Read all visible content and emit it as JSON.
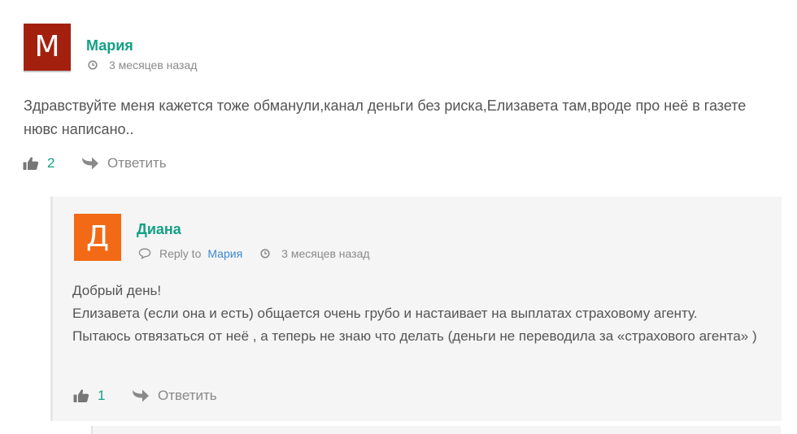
{
  "comment": {
    "avatar_letter": "M",
    "avatar_color": "#a3200f",
    "author": "Мария",
    "time": "3 месяцев назад",
    "text": "Здравствуйте меня кажется тоже обманули,канал деньги без риска,Елизавета там,вроде про неё в газете нювс написано..",
    "likes": "2",
    "reply_label": "Ответить"
  },
  "reply": {
    "avatar_letter": "Д",
    "avatar_color": "#f26a16",
    "author": "Диана",
    "reply_to_prefix": "Reply to",
    "reply_to_name": "Мария",
    "time": "3 месяцев назад",
    "lines": [
      "Добрый день!",
      "Елизавета (если она и есть) общается очень грубо и настаивает на выплатах страховому агенту.",
      "Пытаюсь отвязаться от неё , а теперь не знаю что делать (деньги не переводила за «страхового агента» )"
    ],
    "likes": "1",
    "reply_label": "Ответить"
  },
  "colors": {
    "author": "#14a085",
    "link": "#3a8ad0",
    "reply_bg": "#f5f5f5"
  },
  "icons": {
    "like": "thumbs-up-icon",
    "reply": "reply-arrow-icon",
    "time": "clock-icon",
    "reply_to": "speech-bubble-icon"
  }
}
